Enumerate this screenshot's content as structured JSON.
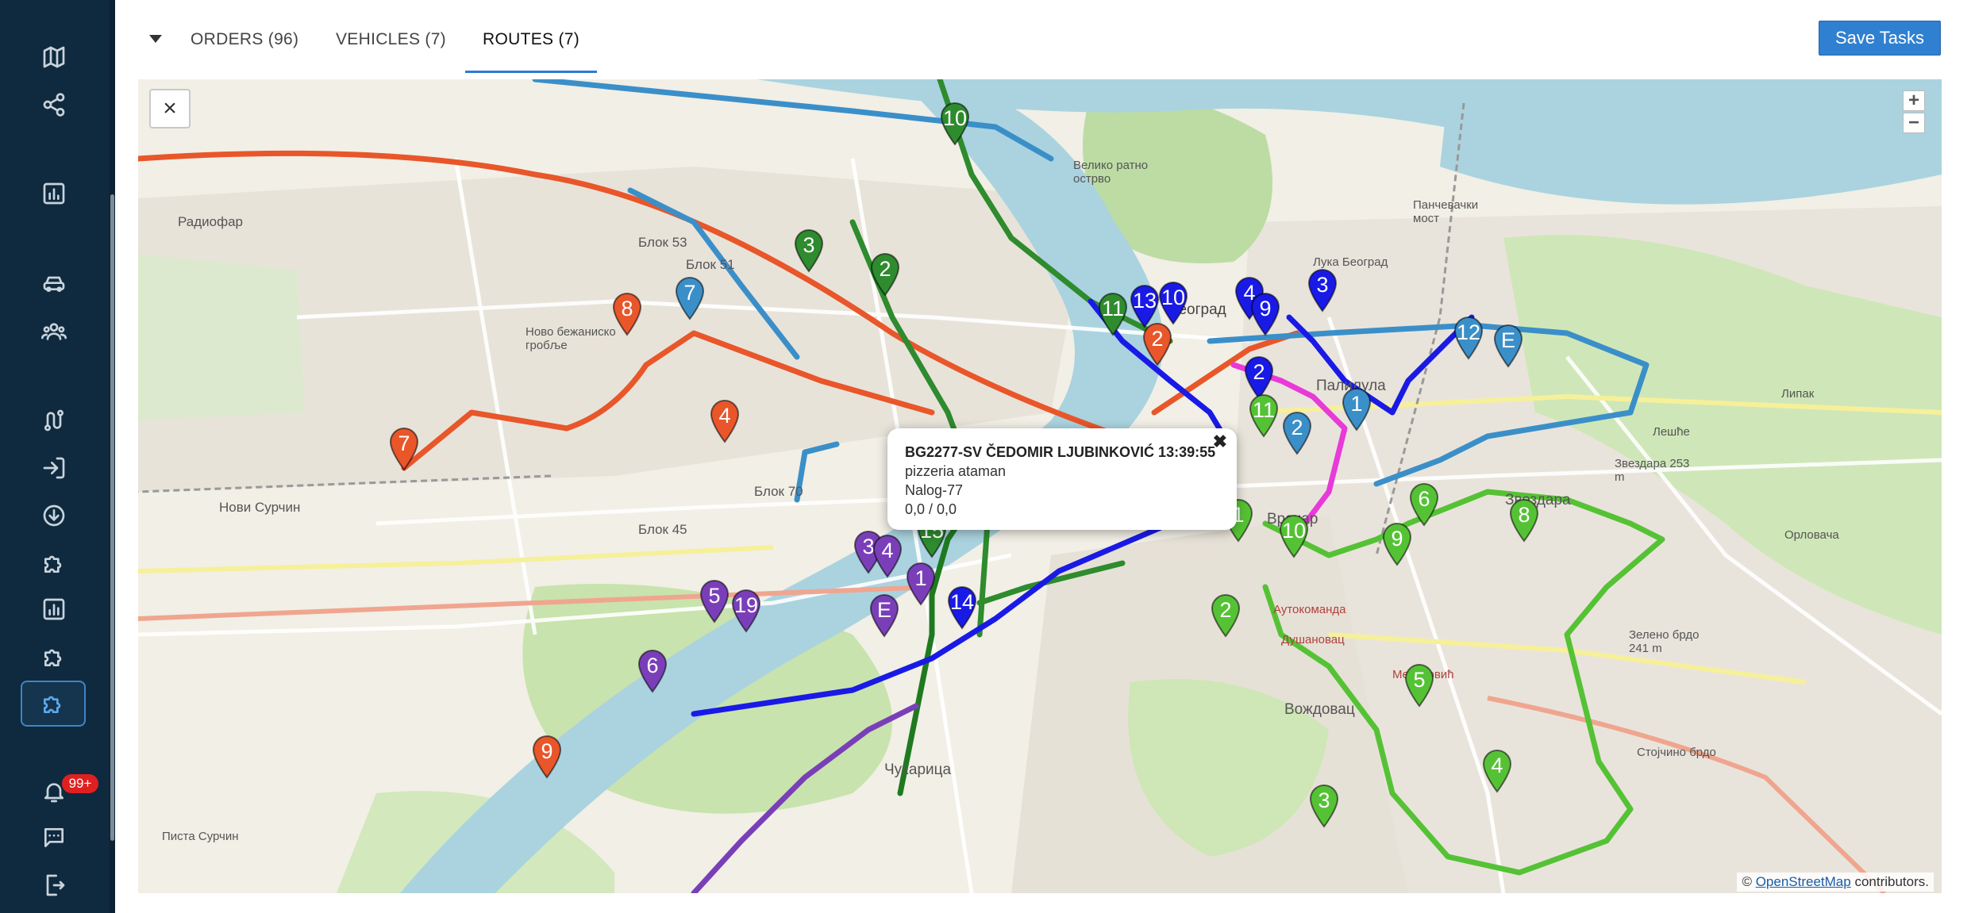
{
  "tabs": [
    {
      "label": "ORDERS (96)"
    },
    {
      "label": "VEHICLES (7)"
    },
    {
      "label": "ROUTES (7)"
    }
  ],
  "save_label": "Save Tasks",
  "sidebar": {
    "icons": [
      "map-icon",
      "share-icon",
      "chart-icon",
      "car-icon",
      "users-icon",
      "route-icon",
      "login-icon",
      "download-icon",
      "puzzle-icon",
      "report-icon",
      "puzzle-icon-2",
      "puzzle-active-icon",
      "bell-icon",
      "chat-icon",
      "logout-icon"
    ],
    "notification_badge": "99+"
  },
  "map": {
    "close_symbol": "×",
    "zoom_in": "+",
    "zoom_out": "−",
    "attribution_prefix": "©",
    "attribution_link": "OpenStreetMap",
    "attribution_suffix": "contributors.",
    "labels": [
      "Радиофар",
      "Нови Сурчин",
      "Блок 53",
      "Блок 51",
      "Блок 45",
      "Блок 70",
      "Ново бежаниско гробље",
      "Велико ратно острво",
      "Панчевачки мост",
      "Лука Београд",
      "Палилула",
      "Звездара",
      "Врачар",
      "Вождовац",
      "Чукарица",
      "Писта Сурчин",
      "Београд",
      "Аутокоманда",
      "Душановац",
      "Медаковић",
      "Лешће",
      "Липак",
      "Звездара 253 m",
      "Зелено брдо 241 m",
      "Стојчино брдо",
      "Орловача"
    ],
    "popup": {
      "title": "BG2277-SV ČEDOMIR LJUBINKOVIĆ 13:39:55",
      "line1": "pizzeria ataman",
      "line2": "Nalog-77",
      "line3": "0,0 / 0,0",
      "close": "✖"
    },
    "colors": {
      "orange": "#e8562a",
      "blue": "#3b8fc9",
      "navy": "#1a1ae6",
      "green": "#2e8b2e",
      "lime": "#55c235",
      "purple": "#7a3fb8",
      "magenta": "#e83ad8"
    },
    "pins": [
      {
        "n": "7",
        "c": "orange"
      },
      {
        "n": "8",
        "c": "orange"
      },
      {
        "n": "4",
        "c": "orange"
      },
      {
        "n": "2",
        "c": "orange"
      },
      {
        "n": "9",
        "c": "orange"
      },
      {
        "n": "7",
        "c": "blue"
      },
      {
        "n": "12",
        "c": "blue"
      },
      {
        "n": "E",
        "c": "blue"
      },
      {
        "n": "1",
        "c": "blue"
      },
      {
        "n": "2",
        "c": "blue"
      },
      {
        "n": "3",
        "c": "green"
      },
      {
        "n": "2",
        "c": "green"
      },
      {
        "n": "10",
        "c": "green"
      },
      {
        "n": "11",
        "c": "green"
      },
      {
        "n": "15",
        "c": "green"
      },
      {
        "n": "13",
        "c": "navy"
      },
      {
        "n": "10",
        "c": "navy"
      },
      {
        "n": "4",
        "c": "navy"
      },
      {
        "n": "9",
        "c": "navy"
      },
      {
        "n": "3",
        "c": "navy"
      },
      {
        "n": "2",
        "c": "navy"
      },
      {
        "n": "14",
        "c": "navy"
      },
      {
        "n": "11",
        "c": "lime"
      },
      {
        "n": "1",
        "c": "lime"
      },
      {
        "n": "10",
        "c": "lime"
      },
      {
        "n": "9",
        "c": "lime"
      },
      {
        "n": "6",
        "c": "lime"
      },
      {
        "n": "8",
        "c": "lime"
      },
      {
        "n": "2",
        "c": "lime"
      },
      {
        "n": "5",
        "c": "lime"
      },
      {
        "n": "4",
        "c": "lime"
      },
      {
        "n": "3",
        "c": "lime"
      },
      {
        "n": "3",
        "c": "purple"
      },
      {
        "n": "4",
        "c": "purple"
      },
      {
        "n": "1",
        "c": "purple"
      },
      {
        "n": "E",
        "c": "purple"
      },
      {
        "n": "5",
        "c": "purple"
      },
      {
        "n": "19",
        "c": "purple"
      },
      {
        "n": "6",
        "c": "purple"
      }
    ]
  }
}
